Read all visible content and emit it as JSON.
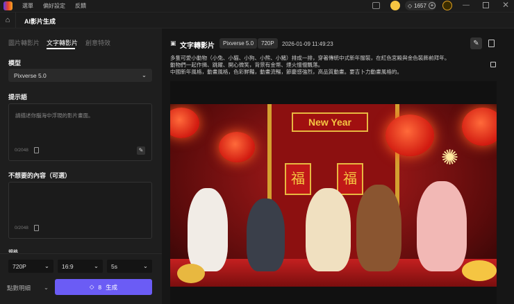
{
  "menu": [
    "選單",
    "偏好設定",
    "反饋"
  ],
  "header": {
    "title": "AI影片生成",
    "credits": "1657"
  },
  "tabs": [
    "圖片轉影片",
    "文字轉影片",
    "創意特效"
  ],
  "active_tab": 1,
  "form": {
    "model_label": "模型",
    "model_value": "Pixverse 5.0",
    "prompt_label": "提示語",
    "prompt_placeholder": "請描述你腦海中浮現的影片畫面。",
    "prompt_count": "0/2048",
    "negative_label": "不想要的內容（可選）",
    "negative_count": "0/2048",
    "cut_label": "規格",
    "resolution": "720P",
    "ratio": "16:9",
    "duration": "5s",
    "points_detail": "點數明細",
    "cost": "8",
    "generate": "生成"
  },
  "result": {
    "title": "文字轉影片",
    "model": "Pixverse 5.0",
    "resolution": "720P",
    "timestamp": "2026-01-09 11:49:23",
    "description": [
      "多隻可愛小動物（小兔、小貓、小狗、小熊、小豬）排成一排，穿著傳統中式新年服裝，在紅色宮殿與金色裝飾前拜年。",
      "動物們一起作揖、跳躍、開心微笑，背景有金幣、煙火慢慢飄落。",
      "中國新年風格，動畫風格，色彩鮮豔，動畫流暢，節慶感強烈，高品質動畫。要吉卜力動畫風格的。"
    ],
    "sign_text": "New Year",
    "couplet_char": "福"
  },
  "colors": {
    "accent": "#6b5cf5",
    "gold": "#f5c542"
  }
}
